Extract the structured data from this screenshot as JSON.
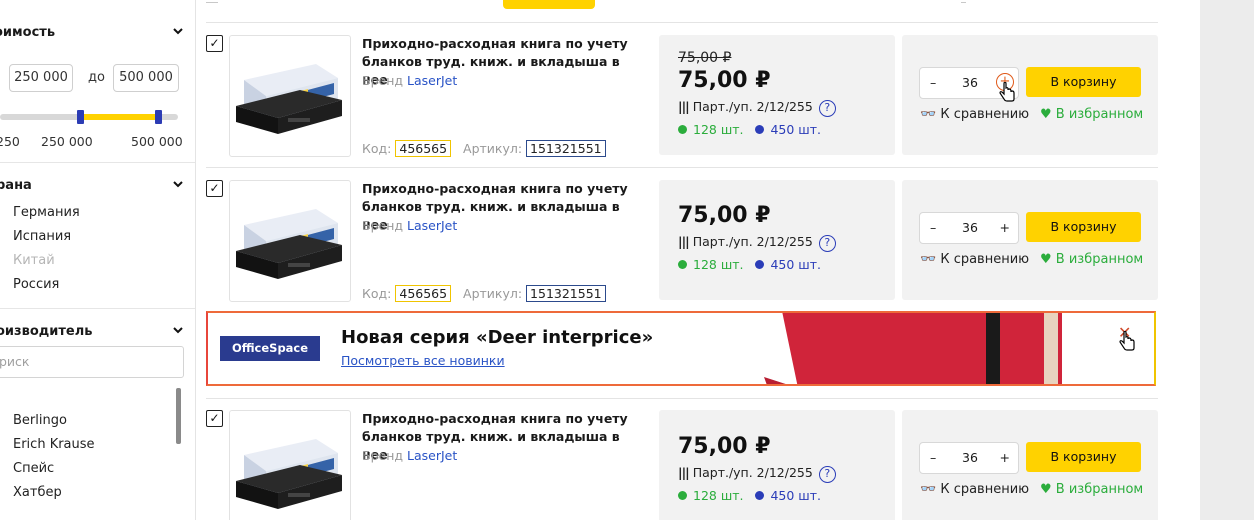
{
  "sidebar": {
    "price_filter": {
      "title": "оимость",
      "from": "250 000",
      "between_label": "до",
      "to": "500 000",
      "range_fraction": {
        "from": 0.45,
        "to": 0.89
      },
      "ticks": [
        "250",
        "250 000",
        "500 000"
      ]
    },
    "country_filter": {
      "title": "рана",
      "options": [
        {
          "label": "Германия",
          "disabled": false
        },
        {
          "label": "Испания",
          "disabled": false
        },
        {
          "label": "Китай",
          "disabled": true
        },
        {
          "label": "Россия",
          "disabled": false
        }
      ]
    },
    "maker_filter": {
      "title": "оизводитель",
      "search_placeholder": "риск",
      "options": [
        "Berlingo",
        "Erich Krause",
        "Спейс",
        "Хатбер"
      ]
    }
  },
  "products": [
    {
      "checked": true,
      "title": "Приходно-расходная книга по учету бланков труд. книж. и вкладыша в нее",
      "brand_label": "Бренд",
      "brand": "LaserJet",
      "code_label": "Код:",
      "code": "456565",
      "article_label": "Артикул:",
      "article": "151321551",
      "old_price": "75,00 ₽",
      "price": "75,00 ₽",
      "pack": "Парт./уп. 2/12/255",
      "stock_green": "128 шт.",
      "stock_blue": "450 шт.",
      "qty": "36",
      "cart_label": "В корзину",
      "compare_label": "К сравнению",
      "fav_label": "В избранном"
    },
    {
      "checked": true,
      "title": "Приходно-расходная книга по учету бланков труд. книж. и вкладыша в нее",
      "brand_label": "Бренд",
      "brand": "LaserJet",
      "code_label": "Код:",
      "code": "456565",
      "article_label": "Артикул:",
      "article": "151321551",
      "price": "75,00 ₽",
      "pack": "Парт./уп. 2/12/255",
      "stock_green": "128 шт.",
      "stock_blue": "450 шт.",
      "qty": "36",
      "cart_label": "В корзину",
      "compare_label": "К сравнению",
      "fav_label": "В избранном"
    },
    {
      "checked": true,
      "title": "Приходно-расходная книга по учету бланков труд. книж. и вкладыша в нее",
      "brand_label": "Бренд",
      "brand": "LaserJet",
      "price": "75,00 ₽",
      "pack": "Парт./уп. 2/12/255",
      "stock_green": "128 шт.",
      "stock_blue": "450 шт.",
      "qty": "36",
      "cart_label": "В корзину",
      "compare_label": "К сравнению",
      "fav_label": "В избранном"
    }
  ],
  "banner": {
    "logo": "OfficeSpace",
    "title": "Новая серия «Deer interprice»",
    "link": "Посмотреть все новинки"
  },
  "colors": {
    "accent_yellow": "#ffd200",
    "brand_blue": "#2b3db8",
    "in_stock_green": "#2bad3c",
    "banner_red": "#d0243a"
  }
}
